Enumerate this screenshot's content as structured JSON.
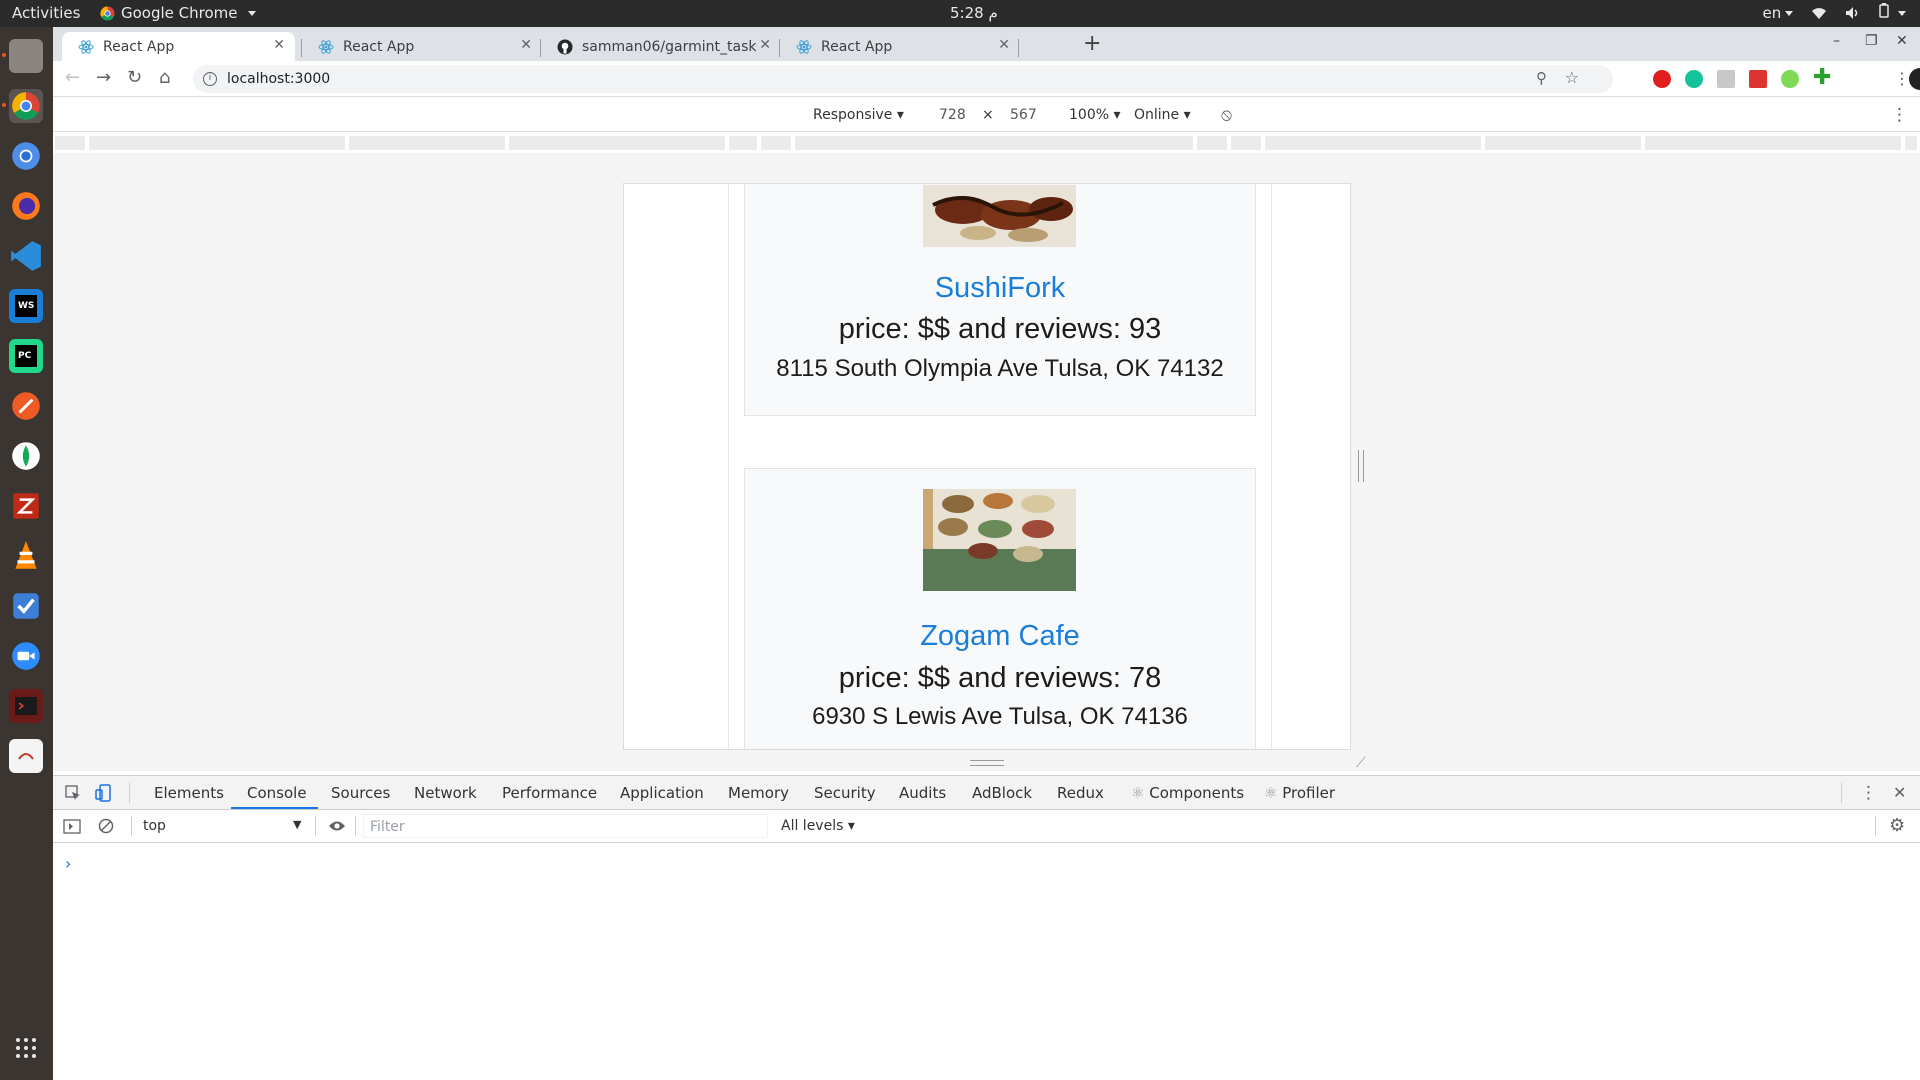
{
  "os": {
    "activities": "Activities",
    "app_menu": "Google Chrome",
    "clock": "5:28 م",
    "lang": "en"
  },
  "browser": {
    "tabs": [
      {
        "label": "React App",
        "active": true
      },
      {
        "label": "React App",
        "active": false
      },
      {
        "label": "samman06/garmint_task",
        "active": false
      },
      {
        "label": "React App",
        "active": false
      }
    ],
    "url": "localhost:3000"
  },
  "device_toolbar": {
    "mode": "Responsive",
    "width": "728",
    "times": "×",
    "height": "567",
    "zoom": "100%",
    "network": "Online"
  },
  "restaurants": [
    {
      "name": "SushiFork",
      "price_reviews": "price: $$ and reviews: 93",
      "address": "8115 South Olympia Ave Tulsa, OK 74132"
    },
    {
      "name": "Zogam Cafe",
      "price_reviews": "price: $$ and reviews: 78",
      "address": "6930 S Lewis Ave Tulsa, OK 74136"
    }
  ],
  "devtools": {
    "tabs": [
      "Elements",
      "Console",
      "Sources",
      "Network",
      "Performance",
      "Application",
      "Memory",
      "Security",
      "Audits",
      "AdBlock",
      "Redux",
      "Components",
      "Profiler"
    ],
    "active_tab": "Console",
    "context": "top",
    "filter_placeholder": "Filter",
    "levels": "All levels",
    "prompt": "›"
  },
  "colors": {
    "link_blue": "#1a7ed8",
    "accent": "#1a73e8",
    "dock_bg": "#3a3530"
  }
}
